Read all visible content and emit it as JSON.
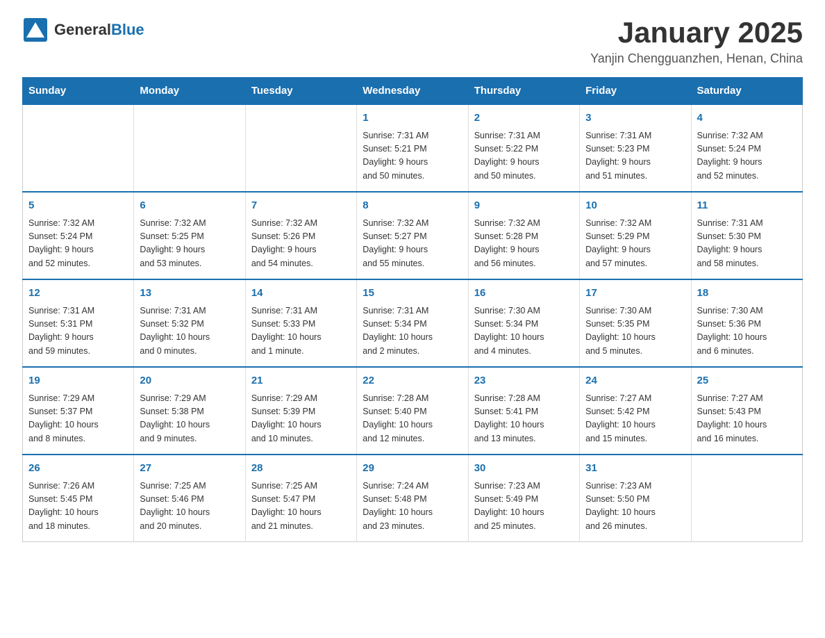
{
  "header": {
    "logo": {
      "general": "General",
      "blue": "Blue"
    },
    "title": "January 2025",
    "location": "Yanjin Chengguanzhen, Henan, China"
  },
  "weekdays": [
    "Sunday",
    "Monday",
    "Tuesday",
    "Wednesday",
    "Thursday",
    "Friday",
    "Saturday"
  ],
  "weeks": [
    [
      {
        "day": "",
        "info": ""
      },
      {
        "day": "",
        "info": ""
      },
      {
        "day": "",
        "info": ""
      },
      {
        "day": "1",
        "info": "Sunrise: 7:31 AM\nSunset: 5:21 PM\nDaylight: 9 hours\nand 50 minutes."
      },
      {
        "day": "2",
        "info": "Sunrise: 7:31 AM\nSunset: 5:22 PM\nDaylight: 9 hours\nand 50 minutes."
      },
      {
        "day": "3",
        "info": "Sunrise: 7:31 AM\nSunset: 5:23 PM\nDaylight: 9 hours\nand 51 minutes."
      },
      {
        "day": "4",
        "info": "Sunrise: 7:32 AM\nSunset: 5:24 PM\nDaylight: 9 hours\nand 52 minutes."
      }
    ],
    [
      {
        "day": "5",
        "info": "Sunrise: 7:32 AM\nSunset: 5:24 PM\nDaylight: 9 hours\nand 52 minutes."
      },
      {
        "day": "6",
        "info": "Sunrise: 7:32 AM\nSunset: 5:25 PM\nDaylight: 9 hours\nand 53 minutes."
      },
      {
        "day": "7",
        "info": "Sunrise: 7:32 AM\nSunset: 5:26 PM\nDaylight: 9 hours\nand 54 minutes."
      },
      {
        "day": "8",
        "info": "Sunrise: 7:32 AM\nSunset: 5:27 PM\nDaylight: 9 hours\nand 55 minutes."
      },
      {
        "day": "9",
        "info": "Sunrise: 7:32 AM\nSunset: 5:28 PM\nDaylight: 9 hours\nand 56 minutes."
      },
      {
        "day": "10",
        "info": "Sunrise: 7:32 AM\nSunset: 5:29 PM\nDaylight: 9 hours\nand 57 minutes."
      },
      {
        "day": "11",
        "info": "Sunrise: 7:31 AM\nSunset: 5:30 PM\nDaylight: 9 hours\nand 58 minutes."
      }
    ],
    [
      {
        "day": "12",
        "info": "Sunrise: 7:31 AM\nSunset: 5:31 PM\nDaylight: 9 hours\nand 59 minutes."
      },
      {
        "day": "13",
        "info": "Sunrise: 7:31 AM\nSunset: 5:32 PM\nDaylight: 10 hours\nand 0 minutes."
      },
      {
        "day": "14",
        "info": "Sunrise: 7:31 AM\nSunset: 5:33 PM\nDaylight: 10 hours\nand 1 minute."
      },
      {
        "day": "15",
        "info": "Sunrise: 7:31 AM\nSunset: 5:34 PM\nDaylight: 10 hours\nand 2 minutes."
      },
      {
        "day": "16",
        "info": "Sunrise: 7:30 AM\nSunset: 5:34 PM\nDaylight: 10 hours\nand 4 minutes."
      },
      {
        "day": "17",
        "info": "Sunrise: 7:30 AM\nSunset: 5:35 PM\nDaylight: 10 hours\nand 5 minutes."
      },
      {
        "day": "18",
        "info": "Sunrise: 7:30 AM\nSunset: 5:36 PM\nDaylight: 10 hours\nand 6 minutes."
      }
    ],
    [
      {
        "day": "19",
        "info": "Sunrise: 7:29 AM\nSunset: 5:37 PM\nDaylight: 10 hours\nand 8 minutes."
      },
      {
        "day": "20",
        "info": "Sunrise: 7:29 AM\nSunset: 5:38 PM\nDaylight: 10 hours\nand 9 minutes."
      },
      {
        "day": "21",
        "info": "Sunrise: 7:29 AM\nSunset: 5:39 PM\nDaylight: 10 hours\nand 10 minutes."
      },
      {
        "day": "22",
        "info": "Sunrise: 7:28 AM\nSunset: 5:40 PM\nDaylight: 10 hours\nand 12 minutes."
      },
      {
        "day": "23",
        "info": "Sunrise: 7:28 AM\nSunset: 5:41 PM\nDaylight: 10 hours\nand 13 minutes."
      },
      {
        "day": "24",
        "info": "Sunrise: 7:27 AM\nSunset: 5:42 PM\nDaylight: 10 hours\nand 15 minutes."
      },
      {
        "day": "25",
        "info": "Sunrise: 7:27 AM\nSunset: 5:43 PM\nDaylight: 10 hours\nand 16 minutes."
      }
    ],
    [
      {
        "day": "26",
        "info": "Sunrise: 7:26 AM\nSunset: 5:45 PM\nDaylight: 10 hours\nand 18 minutes."
      },
      {
        "day": "27",
        "info": "Sunrise: 7:25 AM\nSunset: 5:46 PM\nDaylight: 10 hours\nand 20 minutes."
      },
      {
        "day": "28",
        "info": "Sunrise: 7:25 AM\nSunset: 5:47 PM\nDaylight: 10 hours\nand 21 minutes."
      },
      {
        "day": "29",
        "info": "Sunrise: 7:24 AM\nSunset: 5:48 PM\nDaylight: 10 hours\nand 23 minutes."
      },
      {
        "day": "30",
        "info": "Sunrise: 7:23 AM\nSunset: 5:49 PM\nDaylight: 10 hours\nand 25 minutes."
      },
      {
        "day": "31",
        "info": "Sunrise: 7:23 AM\nSunset: 5:50 PM\nDaylight: 10 hours\nand 26 minutes."
      },
      {
        "day": "",
        "info": ""
      }
    ]
  ],
  "colors": {
    "header_bg": "#1a6faf",
    "accent": "#1a6faf"
  }
}
